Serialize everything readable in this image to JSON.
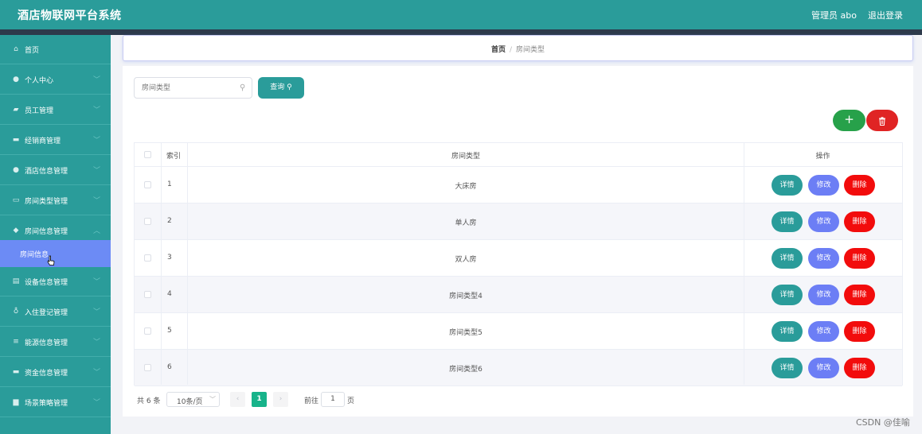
{
  "header": {
    "title": "酒店物联网平台系统",
    "user": "管理员 abo",
    "logout": "退出登录"
  },
  "sidebar": {
    "items": [
      {
        "label": "首页",
        "icon": "home-icon"
      },
      {
        "label": "个人中心",
        "icon": "user-icon"
      },
      {
        "label": "员工管理",
        "icon": "flag-icon"
      },
      {
        "label": "经销商管理",
        "icon": "monitor-icon"
      },
      {
        "label": "酒店信息管理",
        "icon": "user-icon"
      },
      {
        "label": "房间类型管理",
        "icon": "card-icon"
      },
      {
        "label": "房间信息管理",
        "icon": "pin-icon"
      },
      {
        "label": "设备信息管理",
        "icon": "document-icon"
      },
      {
        "label": "入住登记管理",
        "icon": "microphone-icon"
      },
      {
        "label": "能源信息管理",
        "icon": "list-icon"
      },
      {
        "label": "资金信息管理",
        "icon": "monitor-icon"
      },
      {
        "label": "场景策略管理",
        "icon": "folder-icon"
      }
    ],
    "active_sub": "房间信息"
  },
  "breadcrumb": {
    "home": "首页",
    "separator": "/",
    "current": "房间类型"
  },
  "search": {
    "placeholder": "房间类型",
    "button_label": "查询"
  },
  "toolbar": {
    "add_label": "+",
    "delete_icon": "trash-icon"
  },
  "table": {
    "headers": {
      "index": "索引",
      "type": "房间类型",
      "actions": "操作"
    },
    "rows": [
      {
        "index": "1",
        "type": "大床房"
      },
      {
        "index": "2",
        "type": "单人房"
      },
      {
        "index": "3",
        "type": "双人房"
      },
      {
        "index": "4",
        "type": "房间类型4"
      },
      {
        "index": "5",
        "type": "房间类型5"
      },
      {
        "index": "6",
        "type": "房间类型6"
      }
    ],
    "actions": {
      "detail": "详情",
      "edit": "修改",
      "delete": "删除"
    }
  },
  "pagination": {
    "total": "共 6 条",
    "page_size": "10条/页",
    "prev": "‹",
    "current": "1",
    "next": "›",
    "goto": "前往",
    "goto_value": "1",
    "page_unit": "页"
  },
  "watermark": "CSDN @佳喻",
  "colors": {
    "primary": "#2a9c9a",
    "active_sub": "#6c8bf5",
    "edit": "#6c7ef5",
    "delete": "#f20c0c",
    "add": "#27a14a",
    "pager_current": "#17b38a"
  }
}
